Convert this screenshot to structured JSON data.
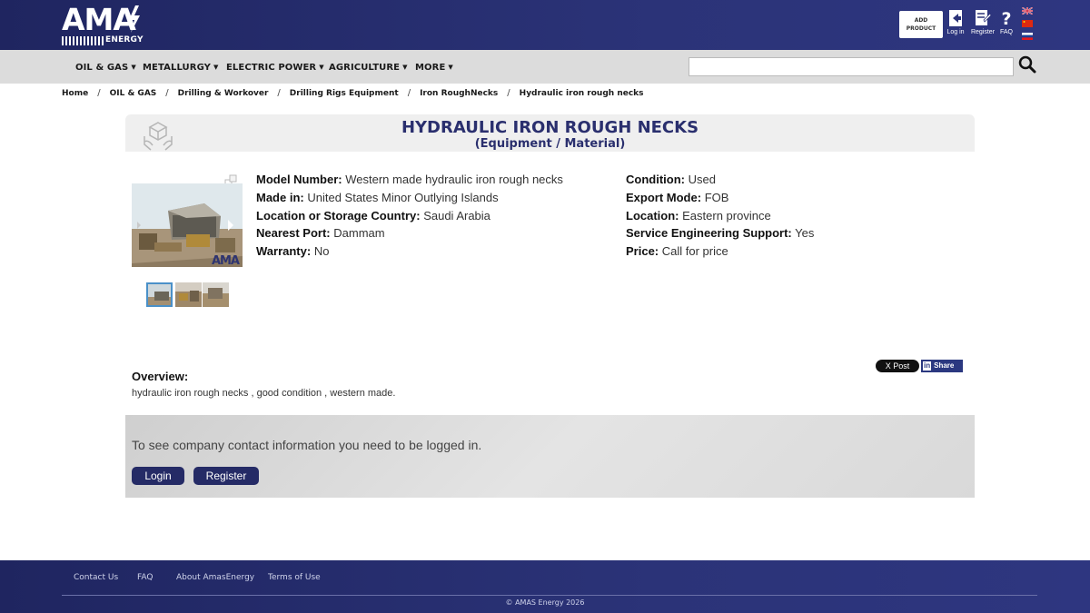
{
  "header": {
    "logo_text": "AMA",
    "logo_sub": "ENERGY",
    "add_product_line1": "ADD",
    "add_product_line2": "PRODUCT",
    "login_label": "Log in",
    "register_label": "Register",
    "faq_label": "FAQ",
    "languages": [
      "english-flag",
      "chinese-flag",
      "russian-flag"
    ]
  },
  "nav": {
    "items": [
      "OIL & GAS",
      "METALLURGY",
      "ELECTRIC POWER",
      "AGRICULTURE",
      "MORE"
    ],
    "search_placeholder": ""
  },
  "breadcrumb": [
    "Home",
    "OIL & GAS",
    "Drilling & Workover",
    "Drilling Rigs Equipment",
    "Iron RoughNecks",
    "Hydraulic iron rough necks"
  ],
  "product": {
    "title": "HYDRAULIC IRON ROUGH NECKS",
    "subtitle": "(Equipment / Material)",
    "image_watermark": "AMA",
    "specs_left": [
      {
        "label": "Model Number:",
        "value": "Western made hydraulic iron rough necks"
      },
      {
        "label": "Made in:",
        "value": "United States Minor Outlying Islands"
      },
      {
        "label": "Location or Storage Country:",
        "value": "Saudi Arabia"
      },
      {
        "label": "Nearest Port:",
        "value": "Dammam"
      },
      {
        "label": "Warranty:",
        "value": "No"
      }
    ],
    "specs_right": [
      {
        "label": "Condition:",
        "value": "Used"
      },
      {
        "label": "Export Mode:",
        "value": "FOB"
      },
      {
        "label": "Location:",
        "value": "Eastern province"
      },
      {
        "label": "Service Engineering Support:",
        "value": "Yes"
      },
      {
        "label": "Price:",
        "value": "Call for price"
      }
    ]
  },
  "share": {
    "x_label": "X Post",
    "linkedin_in": "in",
    "linkedin_label": "Share"
  },
  "overview": {
    "title": "Overview:",
    "text": "hydraulic iron rough necks , good condition , western made."
  },
  "login_box": {
    "message": "To see company contact information you need to be logged in.",
    "login_label": "Login",
    "register_label": "Register"
  },
  "footer": {
    "links": [
      "Contact Us",
      "FAQ",
      "About AmasEnergy",
      "Terms of Use"
    ],
    "copyright": "© AMAS Energy 2026"
  },
  "colors": {
    "header_bg": "#2b3378",
    "nav_bg": "#dcdcdc",
    "title_color": "#2a2f6e",
    "button_bg": "#252b66"
  }
}
